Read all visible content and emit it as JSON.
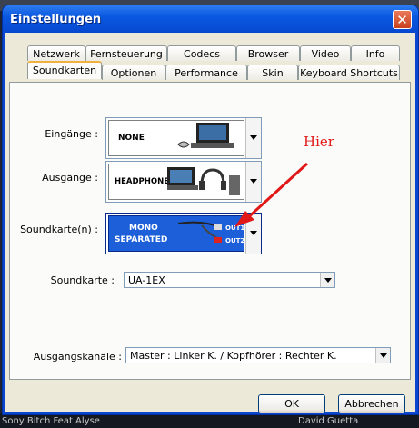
{
  "window": {
    "title": "Einstellungen",
    "close_glyph": "✕"
  },
  "tabs_row1": [
    "Netzwerk",
    "Fernsteuerung",
    "Codecs",
    "Browser",
    "Video",
    "Info"
  ],
  "tabs_row2": [
    "Soundkarten",
    "Optionen",
    "Performance",
    "Skin",
    "Keyboard Shortcuts"
  ],
  "active_tab": "Soundkarten",
  "fields": {
    "eingaenge_label": "Eingänge :",
    "eingaenge_value": "NONE",
    "ausgaenge_label": "Ausgänge :",
    "ausgaenge_value": "HEADPHONES",
    "soundkarten_label": "Soundkarte(n) :",
    "soundkarten_value_line1": "MONO",
    "soundkarten_value_line2": "SEPARATED",
    "out1": "OUT1",
    "out2": "OUT2",
    "soundkarte_label": "Soundkarte :",
    "soundkarte_value": "UA-1EX",
    "ausgangskanaele_label": "Ausgangskanäle :",
    "ausgangskanaele_value": "Master : Linker K. / Kopfhörer : Rechter K."
  },
  "annotation": {
    "text": "Hier",
    "color": "#e01818"
  },
  "buttons": {
    "ok": "OK",
    "cancel": "Abbrechen"
  },
  "background": {
    "left_text": "Sony Bitch Feat Alyse",
    "right_text": "David Guetta"
  },
  "colors": {
    "titlebar": "#0a58e0",
    "dialog_bg": "#ece9d8",
    "tab_highlight": "#f2b13e",
    "mono_panel": "#1d5fd8"
  }
}
